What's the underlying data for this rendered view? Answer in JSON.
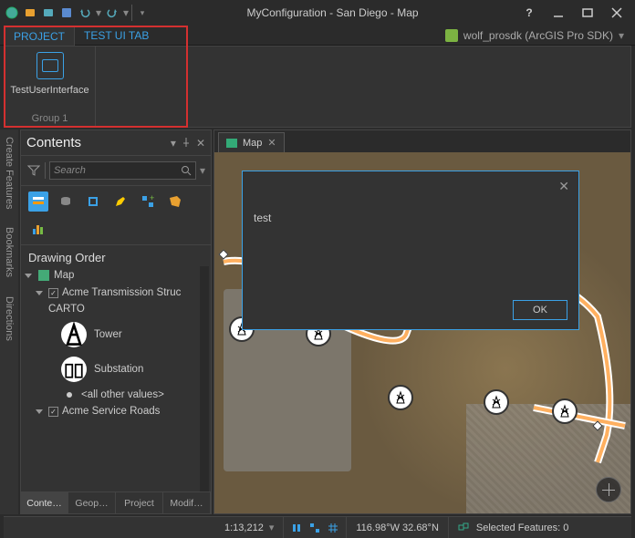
{
  "titlebar": {
    "title": "MyConfiguration - San Diego - Map"
  },
  "user": {
    "name": "wolf_prosdk (ArcGIS Pro SDK)"
  },
  "ribbon": {
    "tab_project": "PROJECT",
    "tab_test": "TEST UI TAB",
    "button_label": "TestUserInterface",
    "group_label": "Group 1"
  },
  "sidebar_rail": {
    "create_features": "Create Features",
    "bookmarks": "Bookmarks",
    "directions": "Directions"
  },
  "contents": {
    "title": "Contents",
    "search_placeholder": "Search",
    "drawing_order": "Drawing Order",
    "root": "Map",
    "layer1": "Acme Transmission Struc",
    "carto": "CARTO",
    "sub_tower": "Tower",
    "sub_substation": "Substation",
    "sub_other": "<all other values>",
    "layer2": "Acme Service Roads",
    "tabs": {
      "contents": "Conte…",
      "geop": "Geop…",
      "project": "Project",
      "modif": "Modif…"
    }
  },
  "mapview": {
    "tab_label": "Map"
  },
  "dialog": {
    "message": "test",
    "ok": "OK"
  },
  "statusbar": {
    "scale": "1:13,212",
    "coords": "116.98°W 32.68°N",
    "selected": "Selected Features: 0"
  }
}
